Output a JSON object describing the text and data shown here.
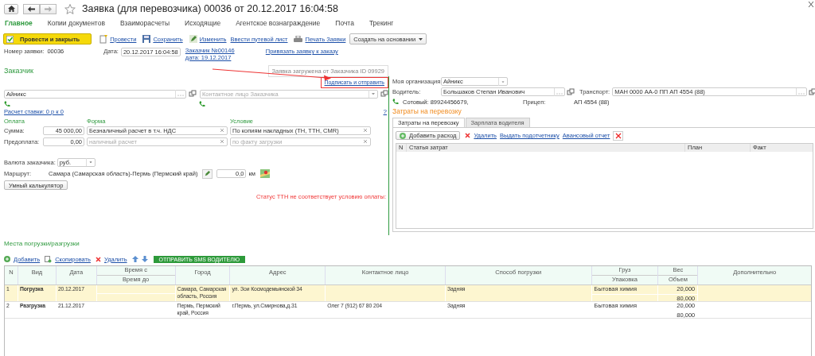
{
  "header": {
    "title": "Заявка (для перевозчика) 00036 от 20.12.2017 16:04:58"
  },
  "tabs": [
    {
      "label": "Главное",
      "selected": true
    },
    {
      "label": "Копии документов",
      "selected": false
    },
    {
      "label": "Взаиморасчеты",
      "selected": false
    },
    {
      "label": "Исходящие",
      "selected": false
    },
    {
      "label": "Агентское вознаграждение",
      "selected": false
    },
    {
      "label": "Почта",
      "selected": false
    },
    {
      "label": "Трекинг",
      "selected": false
    }
  ],
  "toolbar": {
    "primary": "Провести и закрыть",
    "actions": [
      {
        "label": "Провести",
        "kind": "post"
      },
      {
        "label": "Сохранить",
        "kind": "save"
      },
      {
        "label": "Изменить",
        "kind": "edit"
      },
      {
        "label": "Ввести путевой лист",
        "kind": "plain"
      },
      {
        "label": "Печать Заявки",
        "kind": "print"
      }
    ],
    "create_based": "Создать на основании"
  },
  "info": {
    "number_label": "Номер заявки:",
    "number": "00036",
    "date_label": "Дата:",
    "date": "20.12.2017 16:04:58",
    "order_link": "Заказчик №00146 дата: 19.12.2017",
    "bind_link": "Привязать заявку к заказу"
  },
  "customer": {
    "heading": "Заказчик",
    "loaded_note": "Заявка загружена от Заказчика ID 09929",
    "sign_link": "Подписать и отправить",
    "client": "Айникс",
    "contact_placeholder": "Контактное лицо Заказчика",
    "rate_link": "Расчет ставки: 0 р к 0",
    "help": "?",
    "payment_heading": "Оплата",
    "form_heading": "Форма",
    "condition_heading": "Условие",
    "sum_label": "Сумма:",
    "sum": "45 000,00",
    "form": "Безналичный расчет в т.ч. НДС",
    "condition": "По копиям накладных (ТН, ТТН, CMR)",
    "prepay_label": "Предоплата:",
    "prepay": "0,00",
    "prepay_form_placeholder": "наличный расчет",
    "prepay_condition_placeholder": "по факту загрузки",
    "currency_label": "Валюта заказчика:",
    "currency": "руб.",
    "route_label": "Маршрут:",
    "route": "Самара (Самарская область)-Пермь (Пермский край)",
    "distance": "0,0",
    "distance_unit": "км",
    "calc_button": "Умный калькулятор",
    "status_warning": "Статус ТТН не соответствует условию оплаты:"
  },
  "carrier": {
    "org_label": "Моя организация:",
    "org": "Айникс",
    "driver_label": "Водитель:",
    "driver": "Большаков Степан Иванович",
    "transport_label": "Транспорт:",
    "transport": "МАН 0000 АА-0 ПП АП 4554 (88)",
    "phone": "Сотовый: 89924456679,",
    "trailer_label": "Прицеп:",
    "trailer": "АП 4554 (88)"
  },
  "costs": {
    "heading": "Затраты на перевозку",
    "tabs": [
      {
        "label": "Затраты на перевозку",
        "selected": true
      },
      {
        "label": "Зарплата водителя",
        "selected": false
      }
    ],
    "add_button": "Добавить расход",
    "delete": "Удалить",
    "issue": "Выдать подотчетнику",
    "advance": "Авансовый отчет",
    "columns": [
      "N",
      "Статья затрат",
      "План",
      "Факт"
    ]
  },
  "places": {
    "heading": "Места погрузки/разгрузки",
    "add": "Добавить",
    "copy": "Скопировать",
    "delete": "Удалить",
    "sms_button": "ОТПРАВИТЬ SMS ВОДИТЕЛЮ",
    "columns": [
      {
        "top": "N"
      },
      {
        "top": "Вид"
      },
      {
        "top": "Дата"
      },
      {
        "top": "Время с",
        "bottom": "Время до"
      },
      {
        "top": "Город"
      },
      {
        "top": "Адрес"
      },
      {
        "top": "Контактное лицо"
      },
      {
        "top": "Способ погрузки"
      },
      {
        "top": "Груз",
        "bottom": "Упаковка"
      },
      {
        "top": "Вес",
        "bottom": "Объем"
      },
      {
        "top": "Дополнительно"
      }
    ],
    "rows": [
      {
        "n": "1",
        "type": "Погрузка",
        "date": "20.12.2017",
        "city": "Самара, Самарская область, Россия",
        "address": "ул. Зои Космодемьянской 34",
        "method": "Задняя",
        "cargo": "Бытовая химия",
        "weight": "20,000",
        "volume": "80,000",
        "selected": true
      },
      {
        "n": "2",
        "type": "Разгрузка",
        "date": "21.12.2017",
        "city": "Пермь, Пермский край, Россия",
        "address": "г.Пермь, ул.Смирнова,д.31",
        "contact": "Олег 7 (912) 67 80 204",
        "method": "Задняя",
        "cargo": "Бытовая химия",
        "weight": "20,000",
        "volume": "80,000",
        "selected": false
      }
    ]
  }
}
